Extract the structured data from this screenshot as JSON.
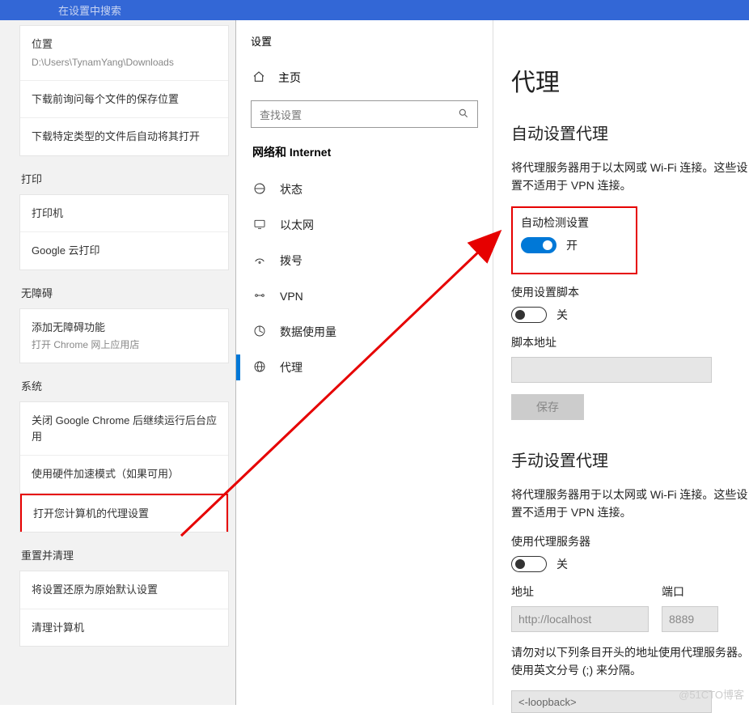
{
  "topbar": {
    "placeholder": "在设置中搜索"
  },
  "chrome": {
    "location_label": "位置",
    "location_path": "D:\\Users\\TynamYang\\Downloads",
    "ask_before_download": "下载前询问每个文件的保存位置",
    "auto_open_file_types": "下载特定类型的文件后自动将其打开",
    "section_print": "打印",
    "printer": "打印机",
    "cloud_print": "Google 云打印",
    "section_accessibility": "无障碍",
    "accessibility_add": "添加无障碍功能",
    "accessibility_sub": "打开 Chrome 网上应用店",
    "section_system": "系统",
    "system_background": "关闭 Google Chrome 后继续运行后台应用",
    "system_hw_accel": "使用硬件加速模式（如果可用）",
    "system_open_proxy": "打开您计算机的代理设置",
    "section_reset": "重置并清理",
    "reset_restore": "将设置还原为原始默认设置",
    "reset_cleanup": "清理计算机"
  },
  "winset": {
    "title": "设置",
    "home": "主页",
    "search_placeholder": "查找设置",
    "group": "网络和 Internet",
    "items": [
      {
        "label": "状态"
      },
      {
        "label": "以太网"
      },
      {
        "label": "拨号"
      },
      {
        "label": "VPN"
      },
      {
        "label": "数据使用量"
      },
      {
        "label": "代理"
      }
    ]
  },
  "proxy": {
    "title": "代理",
    "auto_heading": "自动设置代理",
    "auto_desc": "将代理服务器用于以太网或 Wi-Fi 连接。这些设置不适用于 VPN 连接。",
    "auto_detect": "自动检测设置",
    "on": "开",
    "use_script": "使用设置脚本",
    "off": "关",
    "script_addr": "脚本地址",
    "save": "保存",
    "manual_heading": "手动设置代理",
    "manual_desc": "将代理服务器用于以太网或 Wi-Fi 连接。这些设置不适用于 VPN 连接。",
    "use_proxy_server": "使用代理服务器",
    "addr_label": "地址",
    "addr_value": "http://localhost",
    "port_label": "端口",
    "port_value": "8889",
    "bypass_desc": "请勿对以下列条目开头的地址使用代理服务器。使用英文分号 (;) 来分隔。",
    "bypass_value": "<-loopback>"
  },
  "watermark": "@51CTO博客"
}
